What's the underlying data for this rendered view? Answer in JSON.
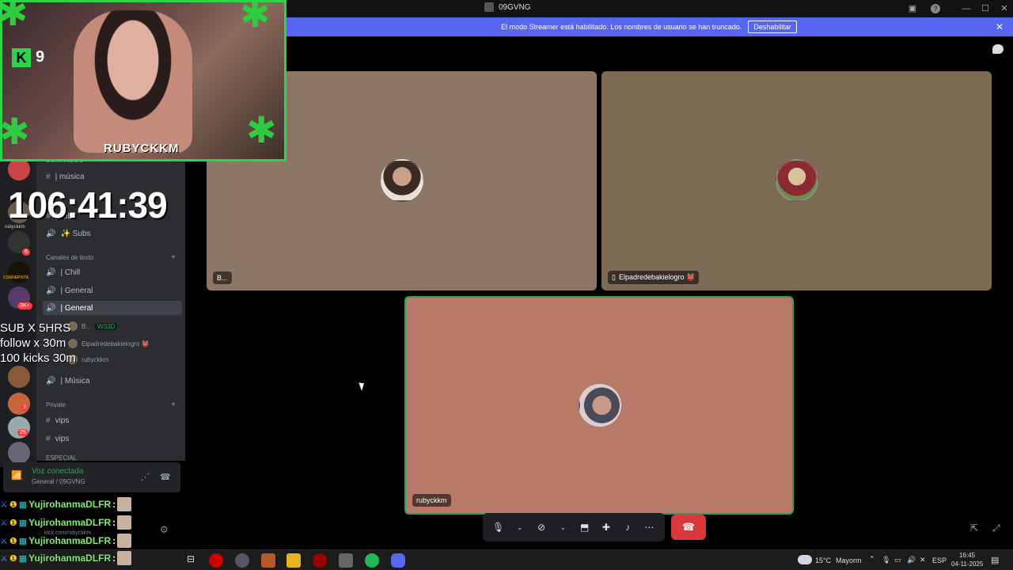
{
  "window": {
    "title": "09GVNG"
  },
  "banner": {
    "text": "El modo Streamer está habilitado. Los nombres de usuario se han truncado.",
    "button": "Deshabilitar"
  },
  "overlay": {
    "webcam_brand": "9",
    "webcam_name": "RUBYCKKM",
    "timer": "106:41:39",
    "lines": [
      "SUB X 5HRS",
      "follow x 30m",
      "100 kicks 30m"
    ],
    "chat": [
      {
        "user": "YujirohanmaDLFR",
        "sep": ":"
      },
      {
        "user": "YujirohanmaDLFR",
        "sep": ":"
      },
      {
        "user": "YujirohanmaDLFR",
        "sep": ":"
      },
      {
        "user": "YujirohanmaDLFR",
        "sep": ":"
      }
    ]
  },
  "guilds": {
    "badges": [
      "6",
      "3K+",
      "3",
      "25"
    ],
    "labels": [
      "rubyckkm",
      "CORNEPISTA"
    ]
  },
  "channels": {
    "top_category": "COMANDOS",
    "items_top": [
      {
        "icon": "#",
        "name": "| música"
      },
      {
        "icon": "#",
        "name": "| sub"
      },
      {
        "icon": "🔊",
        "name": "✨ Subs"
      }
    ],
    "text_category": "Canales de texto",
    "voice": [
      {
        "name": "| Chill"
      },
      {
        "name": "| General"
      },
      {
        "name": "| General"
      }
    ],
    "voice_users": [
      {
        "name": "B...",
        "tag": "W33D"
      },
      {
        "name": "Elpadredebakielogro 👹"
      },
      {
        "name": "rubyckkm"
      }
    ],
    "musica": "| Música",
    "private_category": "Private",
    "private": [
      {
        "name": "vips"
      },
      {
        "name": "vips"
      }
    ],
    "cut_category": "ESPECIAL"
  },
  "voice_panel": {
    "status": "Voz conectada",
    "location": "General / 09GVNG"
  },
  "user_panel": {
    "line": "kick.com/rubyckkm"
  },
  "tiles": [
    {
      "label": "B...",
      "bg": "#8c7665"
    },
    {
      "label": "Elpadredebakielogro 👹",
      "bg": "#7d6a55"
    },
    {
      "label": "rubyckkm",
      "bg": "#b97a6a"
    }
  ],
  "taskbar": {
    "weather": "15°C",
    "weather_label": "Mayorm",
    "lang": "ESP",
    "time": "16:45",
    "date": "04-11-2025"
  },
  "colors": {
    "blurple": "#5865f2",
    "hangup": "#da373c",
    "speaking": "#23a559",
    "webcam_border": "#2dd44a"
  }
}
